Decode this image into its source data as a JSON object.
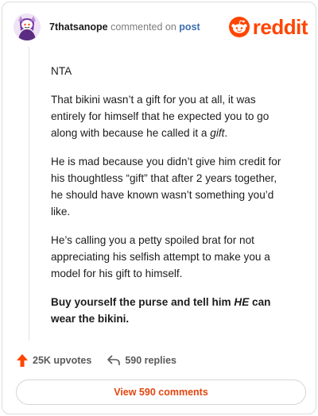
{
  "comment": {
    "username": "7thatsanope",
    "verb": "commented on",
    "post_link": "post",
    "paragraphs": [
      {
        "type": "text",
        "text": "NTA"
      },
      {
        "type": "rich",
        "before": "That bikini wasn’t a gift for you at all, it was entirely for himself that he expected you to go along with because he called it a ",
        "emphasis": "gift",
        "after": "."
      },
      {
        "type": "text",
        "text": "He is mad because you didn’t give him credit for his thoughtless “gift” that after 2 years together, he should have known wasn’t something you’d like."
      },
      {
        "type": "text",
        "text": "He’s calling you a petty spoiled brat for not appreciating his selfish attempt to make you a model for his gift to himself."
      },
      {
        "type": "bold",
        "before": "Buy yourself the purse and tell him ",
        "emphasis": "HE",
        "after": " can wear the bikini."
      }
    ]
  },
  "brand": {
    "name": "reddit",
    "color": "#ff4500"
  },
  "actions": {
    "upvotes": "25K upvotes",
    "replies": "590 replies",
    "view_comments": "View 590 comments"
  },
  "icons": {
    "avatar": "snoo-avatar-icon",
    "logo": "reddit-snoo-icon",
    "upvote": "upvote-arrow-icon",
    "reply": "reply-arrow-icon"
  },
  "colors": {
    "accent": "#ff4500",
    "link": "#3c6fb0",
    "muted": "#7c7c7c"
  }
}
